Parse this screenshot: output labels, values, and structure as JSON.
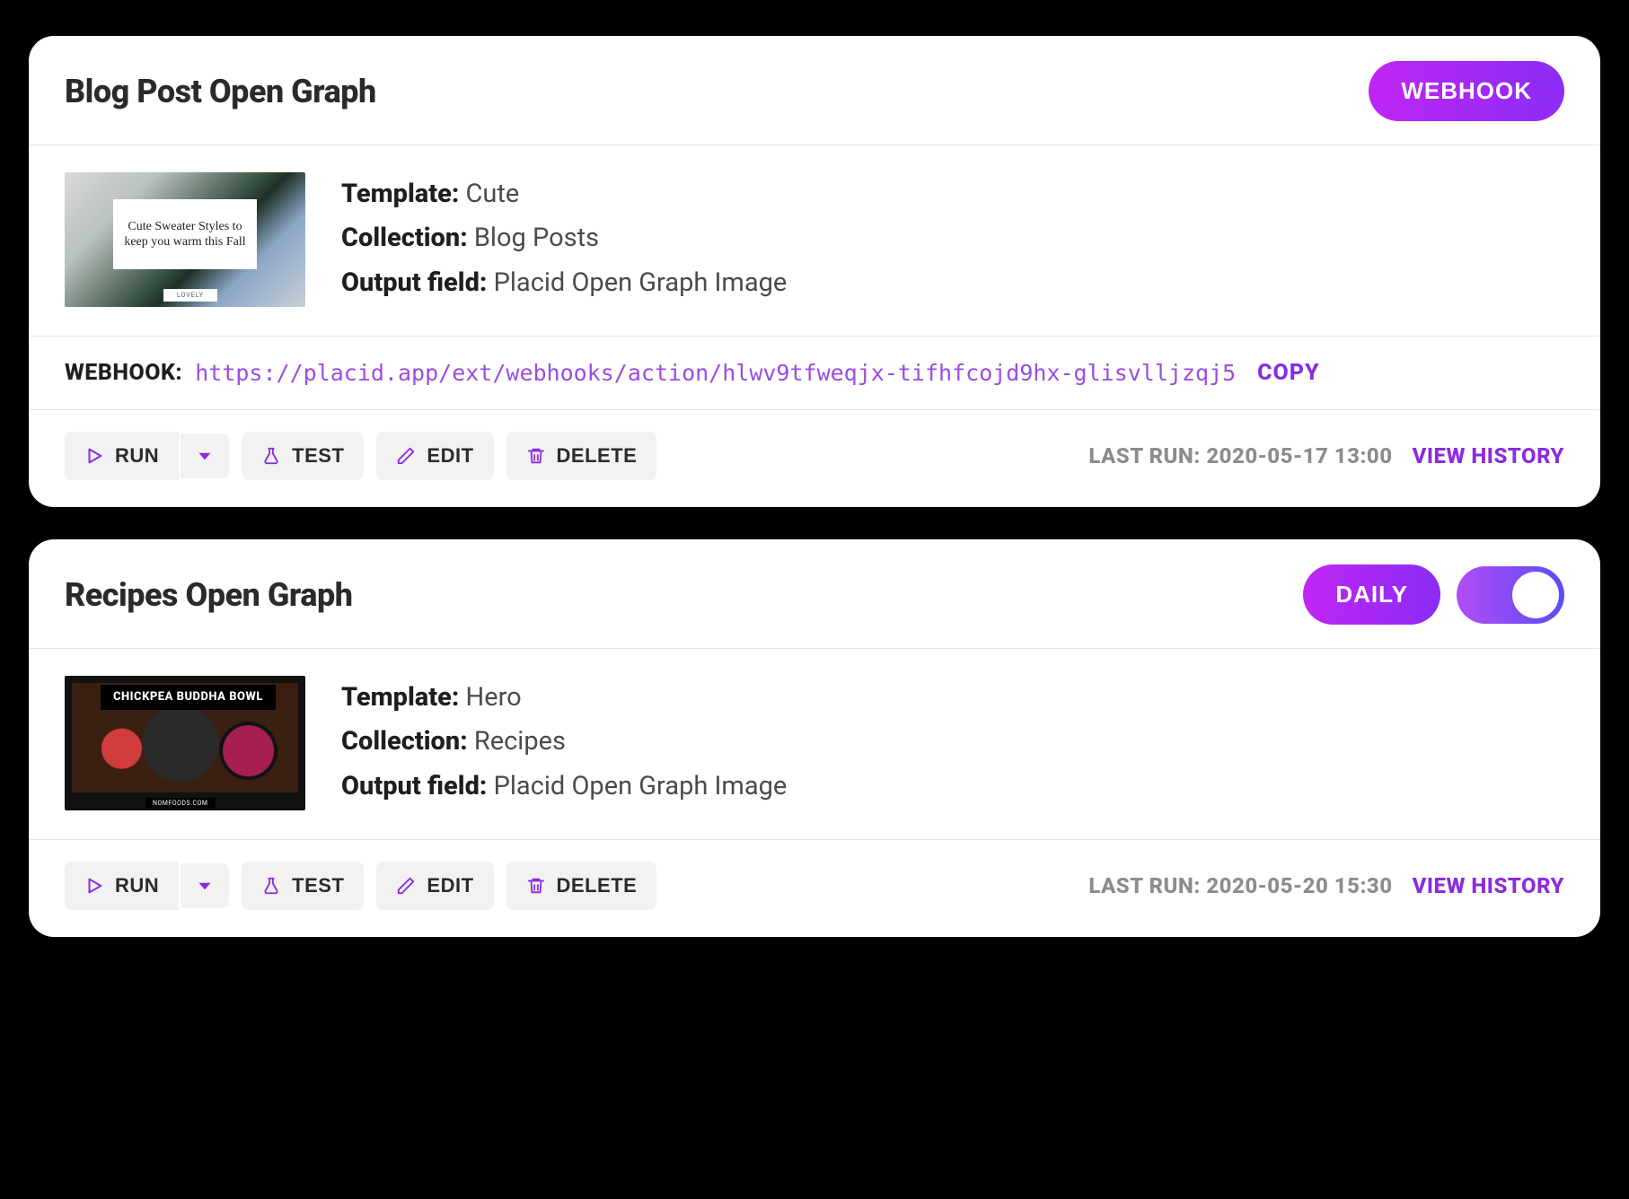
{
  "common": {
    "labels": {
      "template": "Template:",
      "collection": "Collection:",
      "output_field": "Output field:",
      "webhook": "WEBHOOK:",
      "copy": "COPY",
      "run": "RUN",
      "test": "TEST",
      "edit": "EDIT",
      "delete": "DELETE",
      "last_run_prefix": "LAST RUN:",
      "view_history": "VIEW HISTORY"
    }
  },
  "cards": [
    {
      "title": "Blog Post Open Graph",
      "badge": "WEBHOOK",
      "has_toggle": false,
      "template": "Cute",
      "collection": "Blog Posts",
      "output_field": "Placid Open Graph Image",
      "thumb": {
        "style": "sweater",
        "headline": "Cute Sweater Styles to keep you warm this Fall",
        "tag": "LOVELY"
      },
      "webhook_url": "https://placid.app/ext/webhooks/action/hlwv9tfweqjx-tifhfcojd9hx-glisvlljzqj5",
      "last_run": "2020-05-17 13:00"
    },
    {
      "title": "Recipes Open Graph",
      "badge": "DAILY",
      "has_toggle": true,
      "toggle_on": true,
      "template": "Hero",
      "collection": "Recipes",
      "output_field": "Placid Open Graph Image",
      "thumb": {
        "style": "bowl",
        "headline": "CHICKPEA BUDDHA BOWL",
        "tag": "NOMFOODS.COM"
      },
      "webhook_url": null,
      "last_run": "2020-05-20 15:30"
    }
  ]
}
